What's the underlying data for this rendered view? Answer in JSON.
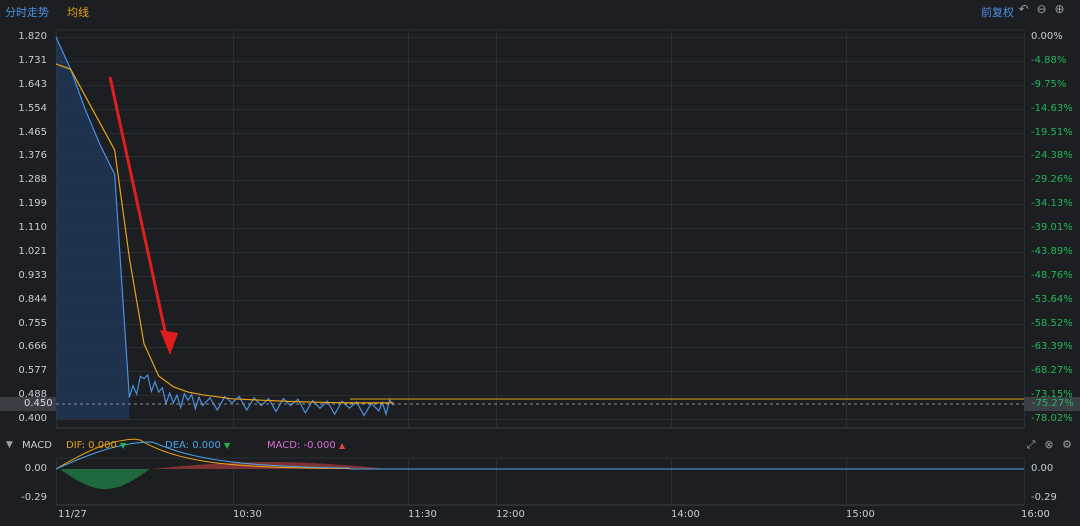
{
  "tabs": {
    "intraday": "分时走势",
    "avg_line": "均线"
  },
  "adjust_label": "前复权",
  "icons": {
    "undo": "undo-icon",
    "zoom_out": "zoom-out-icon",
    "zoom_in": "zoom-in-icon",
    "expand": "expand-icon",
    "close": "close-icon",
    "settings": "gear-icon"
  },
  "price_axis": [
    "1.820",
    "1.731",
    "1.643",
    "1.554",
    "1.465",
    "1.376",
    "1.288",
    "1.199",
    "1.110",
    "1.021",
    "0.933",
    "0.844",
    "0.755",
    "0.666",
    "0.577",
    "0.488",
    "0.400"
  ],
  "pct_axis": [
    "0.00%",
    "-4.88%",
    "-9.75%",
    "-14.63%",
    "-19.51%",
    "-24.38%",
    "-29.26%",
    "-34.13%",
    "-39.01%",
    "-43.89%",
    "-48.76%",
    "-53.64%",
    "-58.52%",
    "-63.39%",
    "-68.27%",
    "-73.15%",
    "-78.02%"
  ],
  "current": {
    "price": "0.450",
    "pct": "-75.27%"
  },
  "macd": {
    "title": "MACD",
    "dif_label": "DIF: 0.000",
    "dea_label": "DEA: 0.000",
    "macd_label": "MACD: -0.000",
    "axis": [
      "0.00",
      "-0.29"
    ],
    "axis_right": [
      "0.00",
      "-0.29"
    ]
  },
  "time_axis": [
    "11/27",
    "10:30",
    "11:30",
    "12:00",
    "14:00",
    "15:00",
    "16:00"
  ],
  "colors": {
    "price_line": "#4a8fe0",
    "avg_line": "#e6a21b",
    "up": "#e04545",
    "down": "#23b45a",
    "arrow": "#e01e1e"
  },
  "chart_data": {
    "type": "line",
    "ylim": [
      0.4,
      1.82
    ],
    "series": [
      {
        "name": "分时",
        "x": [
          "09:30",
          "09:35",
          "09:40",
          "09:45",
          "09:50",
          "09:55",
          "10:00",
          "10:05",
          "10:10",
          "10:15",
          "10:20",
          "10:30",
          "10:40",
          "10:50",
          "11:00",
          "11:10",
          "11:20",
          "11:25"
        ],
        "values": [
          1.82,
          1.7,
          1.55,
          1.42,
          1.31,
          0.48,
          0.55,
          0.5,
          0.46,
          0.47,
          0.45,
          0.46,
          0.45,
          0.45,
          0.44,
          0.44,
          0.43,
          0.45
        ]
      },
      {
        "name": "均线",
        "x": [
          "09:30",
          "09:35",
          "09:40",
          "09:45",
          "09:50",
          "09:55",
          "10:00",
          "10:05",
          "10:10",
          "10:15",
          "10:20",
          "10:30",
          "10:40",
          "10:50",
          "11:00",
          "11:10",
          "11:20",
          "11:25"
        ],
        "values": [
          1.72,
          1.7,
          1.6,
          1.5,
          1.4,
          1.0,
          0.68,
          0.56,
          0.52,
          0.5,
          0.49,
          0.475,
          0.47,
          0.465,
          0.462,
          0.46,
          0.46,
          0.46
        ]
      }
    ]
  }
}
